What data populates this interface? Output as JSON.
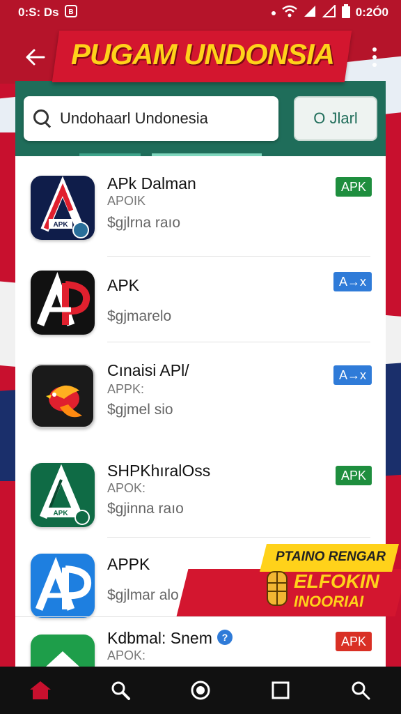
{
  "status_bar": {
    "time": "0:S: Ds",
    "clock": "0:2Ó0",
    "icons": [
      "screenshot-icon",
      "dot-icon",
      "wifi-icon",
      "signal-icon",
      "signal-icon",
      "battery-icon"
    ]
  },
  "header": {
    "title": "PUGAM UNDONSIA",
    "back_icon": "back-arrow-icon",
    "menu_icon": "more-vert-icon"
  },
  "search": {
    "value": "Undohaarl Undonesia",
    "button_label": "O Jlarl"
  },
  "apps": [
    {
      "name": "APk Dalman",
      "sub": "APOIK",
      "meta": "$gjlrna raıo",
      "badge": "APK",
      "badge_color": "#1e8e3e",
      "icon": "apk-a-icon-navy"
    },
    {
      "name": "APK",
      "sub": "",
      "meta": "$gjmarelo",
      "badge": "A→x",
      "badge_color": "#2f7bd8",
      "icon": "apk-ap-icon-black"
    },
    {
      "name": "Cınaisi APl/",
      "sub": "APPK:",
      "meta": "$gjmel sio",
      "badge": "A→x",
      "badge_color": "#2f7bd8",
      "icon": "bird-icon"
    },
    {
      "name": "SHPKhıralOss",
      "sub": "APOK:",
      "meta": "$gjinna raıo",
      "badge": "APK",
      "badge_color": "#1e8e3e",
      "icon": "apk-a-icon-green"
    },
    {
      "name": "APPK",
      "sub": "",
      "meta": "$gjlmar alo",
      "badge": "",
      "badge_color": "#2f7bd8",
      "icon": "apk-ap-icon-blue"
    },
    {
      "name": "Kdbmal: Snem",
      "sub": "APOK:",
      "meta": "",
      "badge": "APK",
      "badge_color": "#d93025",
      "icon": "house-icon"
    }
  ],
  "promo": {
    "line1": "PTAINO RENGAR",
    "line2": "ELFOKIN",
    "line3": "INOORIAI"
  },
  "nav": [
    "home-icon",
    "search-icon",
    "circle-home-icon",
    "recents-icon",
    "search-alt-icon"
  ],
  "colors": {
    "brand_red": "#d3162f",
    "title_yellow": "#ffd21a",
    "search_green": "#1f6d5a",
    "nav_active": "#c8102e"
  }
}
